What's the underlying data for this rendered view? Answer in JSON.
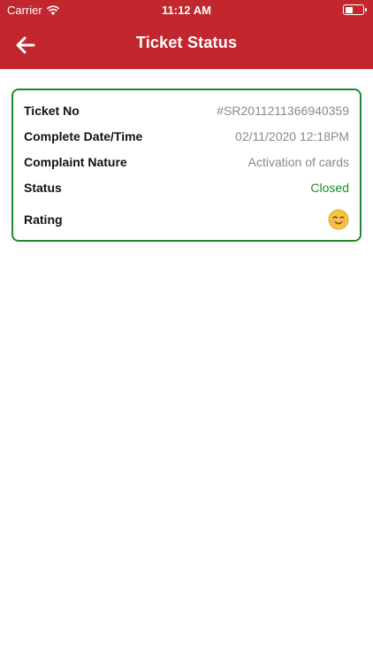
{
  "status_bar": {
    "carrier": "Carrier",
    "time": "11:12 AM"
  },
  "header": {
    "title": "Ticket Status"
  },
  "ticket": {
    "rows": [
      {
        "label": "Ticket No",
        "value": "#SR2011211366940359"
      },
      {
        "label": "Complete Date/Time",
        "value": "02/11/2020 12:18PM"
      },
      {
        "label": "Complaint Nature",
        "value": "Activation of cards"
      },
      {
        "label": "Status",
        "value": "Closed"
      }
    ],
    "rating_label": "Rating",
    "rating_icon": "smiling-face-icon"
  },
  "colors": {
    "header": "#c1272d",
    "accent_green": "#1f8a2b",
    "value_gray": "#8a8a8a"
  }
}
